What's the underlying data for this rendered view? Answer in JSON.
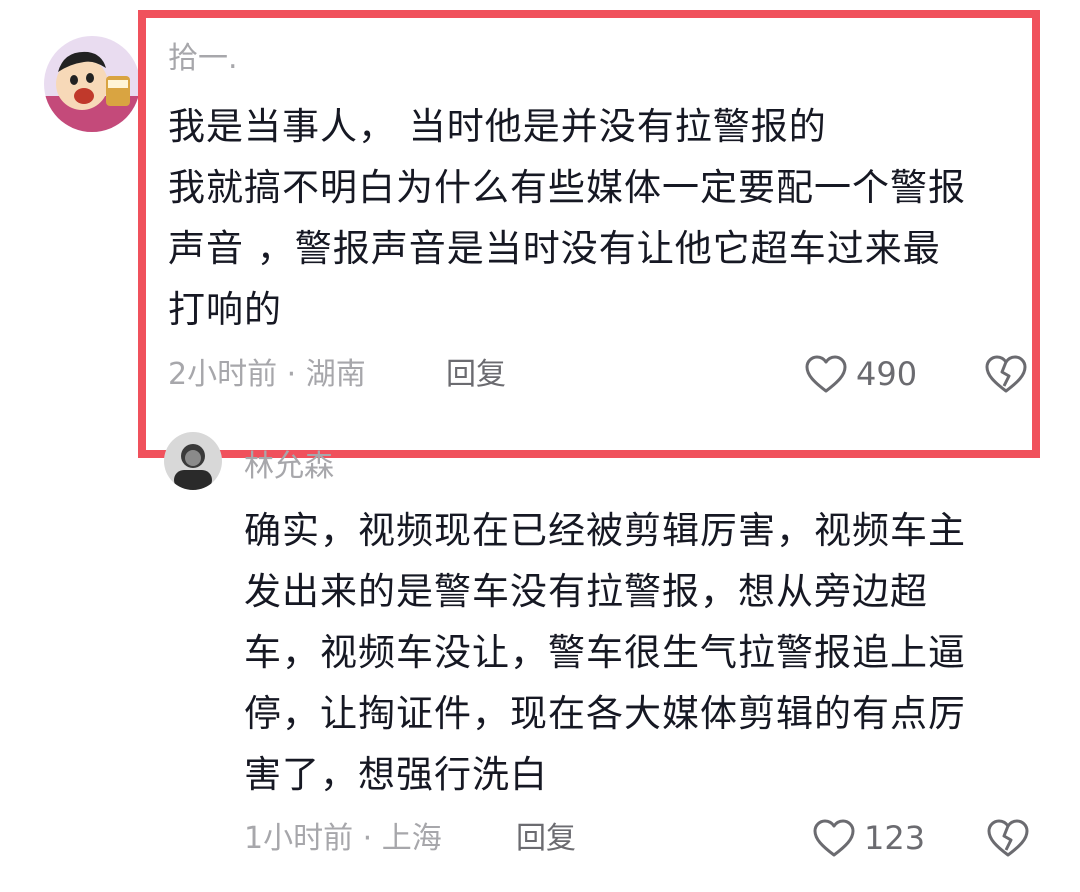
{
  "comments": [
    {
      "username": "拾一.",
      "lines": [
        "我是当事人， 当时他是并没有拉警报的",
        "我就搞不明白为什么有些媒体一定要配一个警报",
        "声音 ，警报声音是当时没有让他它超车过来最",
        "打响的"
      ],
      "meta": "2小时前 · 湖南",
      "reply_label": "回复",
      "likes": "490",
      "avatar_icon": "cartoon-boy-avatar"
    },
    {
      "username": "林允森",
      "lines": [
        "确实，视频现在已经被剪辑厉害，视频车主",
        "发出来的是警车没有拉警报，想从旁边超",
        "车，视频车没让，警车很生气拉警报追上逼",
        "停，让掏证件，现在各大媒体剪辑的有点厉",
        "害了，想强行洗白"
      ],
      "meta": "1小时前 · 上海",
      "reply_label": "回复",
      "likes": "123",
      "avatar_icon": "person-photo-avatar"
    }
  ],
  "colors": {
    "highlight": "#f0515c",
    "text": "#161823",
    "muted": "#a7a7ab",
    "icon": "#6b6b70"
  }
}
